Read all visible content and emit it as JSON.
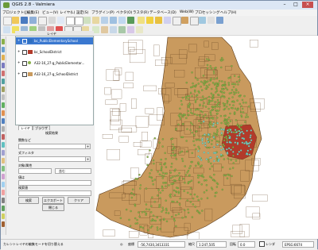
{
  "window": {
    "title": "QGIS 2.8 - Valmiera"
  },
  "menubar": {
    "items": [
      "プロジェクト(J)",
      "編集(E)",
      "ビュー(V)",
      "レイヤ(L)",
      "設定(S)",
      "プラグイン(P)",
      "ベクタ(O)",
      "ラスタ(R)",
      "データベース(D)",
      "Web(W)",
      "プロセッシング",
      "ヘルプ(H)"
    ]
  },
  "layers_panel": {
    "header": "レイヤ",
    "layers": [
      {
        "name": "bc_PublicElementarySchool",
        "selected": true,
        "color": "#2f6fbf"
      },
      {
        "name": "bc_SchoolDistrict",
        "selected": false,
        "color": "#b23a2a"
      },
      {
        "name": "A32-16_27-g_PublicElementar...",
        "selected": false,
        "color": "#8ab04a"
      },
      {
        "name": "A32-16_27-g_SchoolDistrict",
        "selected": false,
        "color": "#c99a5e"
      }
    ]
  },
  "tabs": [
    "レイヤ",
    "ブラウザ"
  ],
  "query_panel": {
    "title": "検索結果",
    "field1_label": "関数など",
    "field2_label": "式フィルタ",
    "field3_label": "対象/属性",
    "op_value": "含む",
    "value_label": "値は",
    "value2_label": "検索値",
    "buttons": {
      "select": "検索",
      "export": "エクスポート",
      "clear": "クリア",
      "close": "閉じる"
    }
  },
  "statusbar": {
    "message": "カレントレイヤの編集モードを切り替える",
    "coordinate_label": "座標",
    "coordinate": "-56,7430,3413331",
    "scale_label": "縮尺",
    "scale": "1:247,505",
    "rotation_label": "回転",
    "rotation": "0.0",
    "render_label": "レンダ",
    "epsg": "EPSG:6674"
  },
  "map": {
    "background": "#ffffff",
    "district_fill": "#c99a5e",
    "district_stroke": "#5a3a1a",
    "highlight_fill": "#b23a2a",
    "school_point": "#8ab04a",
    "selected_point": "#7fd3c3"
  }
}
